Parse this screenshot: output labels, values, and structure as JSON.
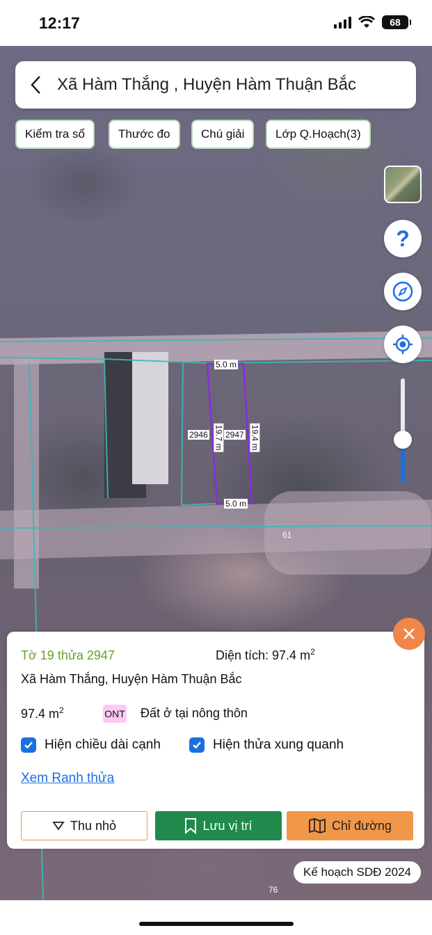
{
  "status": {
    "time": "12:17",
    "battery": "68"
  },
  "search": {
    "title": "Xã Hàm Thắng , Huyện Hàm Thuận Bắc"
  },
  "toolbar": {
    "check_label": "Kiểm tra sổ",
    "measure_label": "Thước đo",
    "legend_label": "Chú giải",
    "layer_label": "Lớp Q.Hoạch(3)"
  },
  "map": {
    "parcel_width_top": "5.0 m",
    "parcel_width_bottom": "5.0 m",
    "parcel_left_edge": "19.7 m",
    "parcel_right_edge": "19.4 m",
    "neighbor_parcel": "2946",
    "selected_parcel": "2947",
    "label_61": "61",
    "label_76": "76"
  },
  "panel": {
    "sheet_parcel": "Tờ 19 thửa 2947",
    "area_label": "Diện tích: 97.4 m",
    "area_sup": "2",
    "location": "Xã Hàm Thắng, Huyện Hàm Thuận Bắc",
    "area_value": "97.4 m",
    "area_value_sup": "2",
    "land_code": "ONT",
    "land_type": "Đất ở tại nông thôn",
    "show_edges_label": "Hiện chiều dài cạnh",
    "show_neighbors_label": "Hiện thửa xung quanh",
    "boundary_link": "Xem Ranh thửa",
    "collapse_label": "Thu nhỏ",
    "save_label": "Lưu vị trí",
    "directions_label": "Chỉ đường"
  },
  "plan_badge": "Kế hoạch SDĐ 2024",
  "colors": {
    "accent_blue": "#1d6fe0",
    "green": "#1f8a4c",
    "orange": "#f0974a",
    "parcel_outline": "#8a2be2"
  }
}
